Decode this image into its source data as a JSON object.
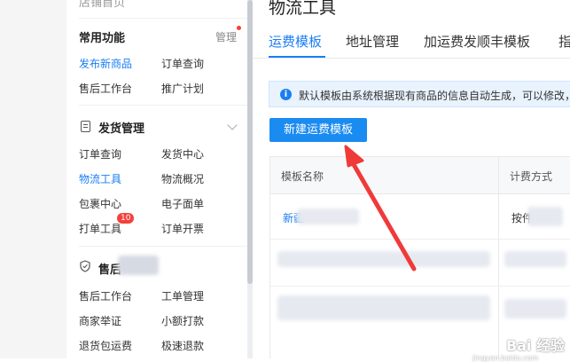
{
  "sidebar": {
    "top_cut_label": "店铺首页",
    "common": {
      "title": "常用功能",
      "manage_label": "管理",
      "items": [
        "发布新商品",
        "订单查询",
        "售后工作台",
        "推广计划"
      ]
    },
    "shipping": {
      "title": "发货管理",
      "items": [
        "订单查询",
        "发货中心",
        "物流工具",
        "物流概况",
        "包裹中心",
        "电子面单",
        "打单工具",
        "订单开票"
      ],
      "badge": "10"
    },
    "aftersale": {
      "title": "售后",
      "items": [
        "售后工作台",
        "工单管理",
        "商家举证",
        "小额打款",
        "退货包运费",
        "极速退款"
      ]
    }
  },
  "main": {
    "page_title": "物流工具",
    "tabs": [
      "运费模板",
      "地址管理",
      "加运费发顺丰模板",
      "指"
    ],
    "info_text": "默认模板由系统根据现有商品的信息自动生成，可以修改，",
    "new_button_label": "新建运费模板",
    "table": {
      "headers": [
        "模板名称",
        "计费方式"
      ],
      "row1_name": "新疆",
      "row1_method": "按件"
    }
  },
  "watermark": {
    "main": "Bai 经验",
    "sub": "jingyan.baidu.com"
  },
  "colors": {
    "accent": "#1a7ef4",
    "button": "#1a8bf0",
    "badge": "#f5403a",
    "annotation_arrow": "#f03a3a",
    "info_bg": "#e9f3fe"
  }
}
